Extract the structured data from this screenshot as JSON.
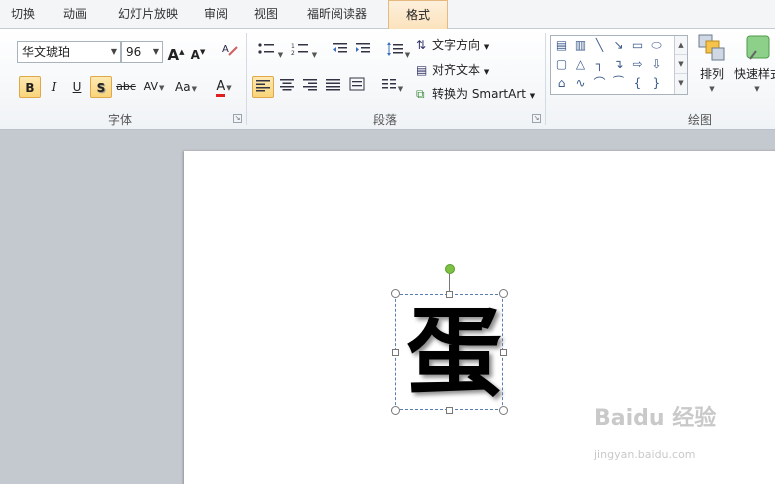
{
  "tabs": [
    {
      "label": "切换"
    },
    {
      "label": "动画"
    },
    {
      "label": "幻灯片放映"
    },
    {
      "label": "审阅"
    },
    {
      "label": "视图"
    },
    {
      "label": "福昕阅读器"
    },
    {
      "label": "格式",
      "active": true
    }
  ],
  "font_group": {
    "label": "字体",
    "font_name": "华文琥珀",
    "font_size": "96",
    "grow_glyph": "A",
    "shrink_glyph": "A",
    "bold": "B",
    "italic": "I",
    "underline": "U",
    "shadow": "S",
    "strikethrough": "abc",
    "char_spacing": "AV",
    "change_case": "Aa",
    "font_color_glyph": "A"
  },
  "paragraph_group": {
    "label": "段落",
    "text_direction": "文字方向",
    "align_text": "对齐文本",
    "convert_smartart": "转换为 SmartArt"
  },
  "drawing_group": {
    "label": "绘图",
    "arrange": "排列",
    "quick_styles": "快速样式"
  },
  "slide": {
    "text": "蛋"
  },
  "watermark": {
    "brand": "Baidu 经验",
    "url": "jingyan.baidu.com"
  },
  "colors": {
    "accent": "#e6b981",
    "selection": "#5a7fb5",
    "rotate_handle": "#7cc142",
    "font_color": "#e02020"
  }
}
